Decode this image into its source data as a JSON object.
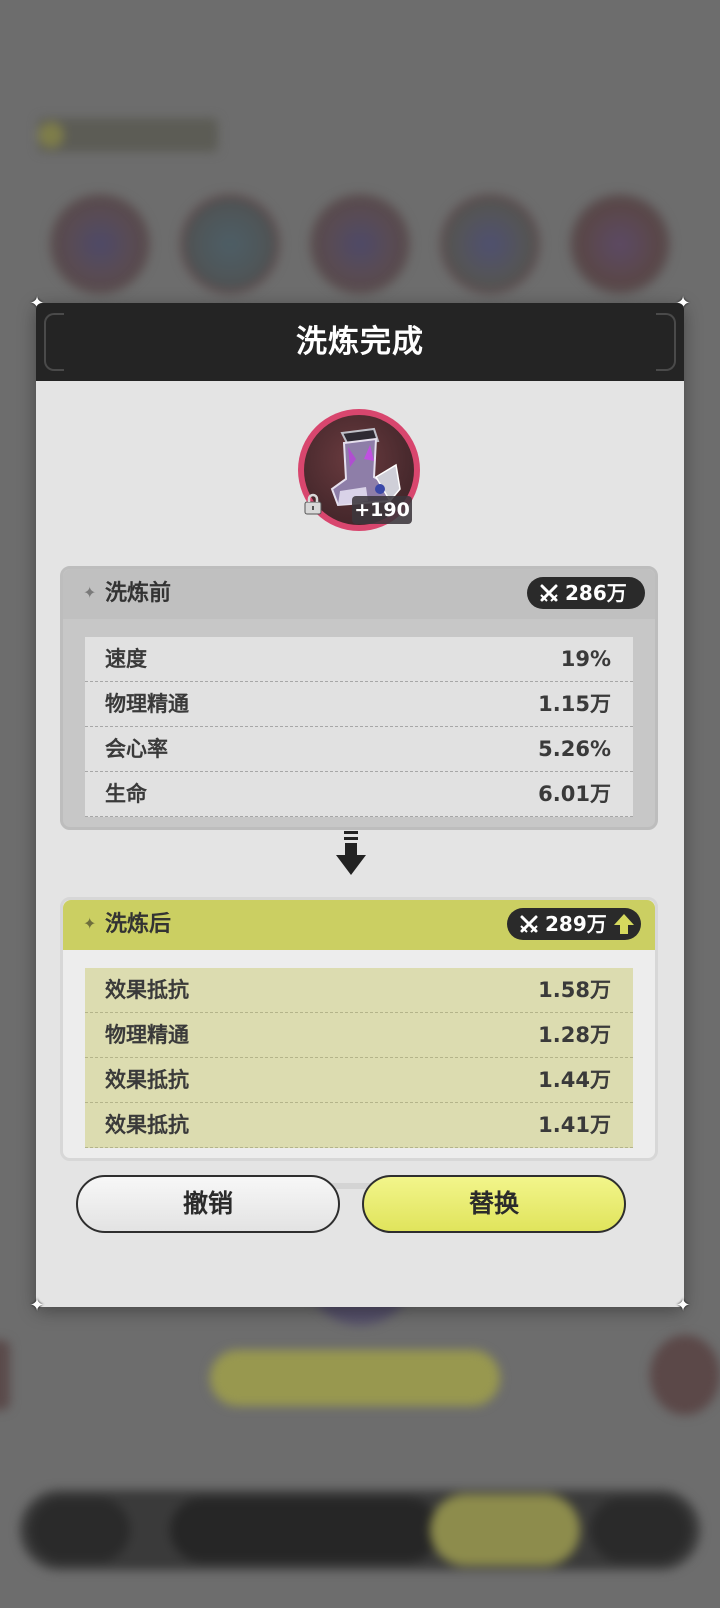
{
  "dialog": {
    "title": "洗炼完成"
  },
  "item": {
    "level_badge": "+190",
    "icon_name": "boots-icon",
    "lock_icon": "lock-icon"
  },
  "before": {
    "label": "洗炼前",
    "power": "286万",
    "stats": [
      {
        "name": "速度",
        "value": "19%"
      },
      {
        "name": "物理精通",
        "value": "1.15万"
      },
      {
        "name": "会心率",
        "value": "5.26%"
      },
      {
        "name": "生命",
        "value": "6.01万"
      }
    ]
  },
  "after": {
    "label": "洗炼后",
    "power": "289万",
    "stats": [
      {
        "name": "效果抵抗",
        "value": "1.58万"
      },
      {
        "name": "物理精通",
        "value": "1.28万"
      },
      {
        "name": "效果抵抗",
        "value": "1.44万"
      },
      {
        "name": "效果抵抗",
        "value": "1.41万"
      }
    ]
  },
  "buttons": {
    "cancel_label": "撤销",
    "replace_label": "替换"
  },
  "colors": {
    "header_bg": "#242424",
    "dialog_bg": "#e4e4e4",
    "after_accent": "#cbcf62",
    "replace_button": "#e6ea6a",
    "item_ring": "#d8466e"
  }
}
